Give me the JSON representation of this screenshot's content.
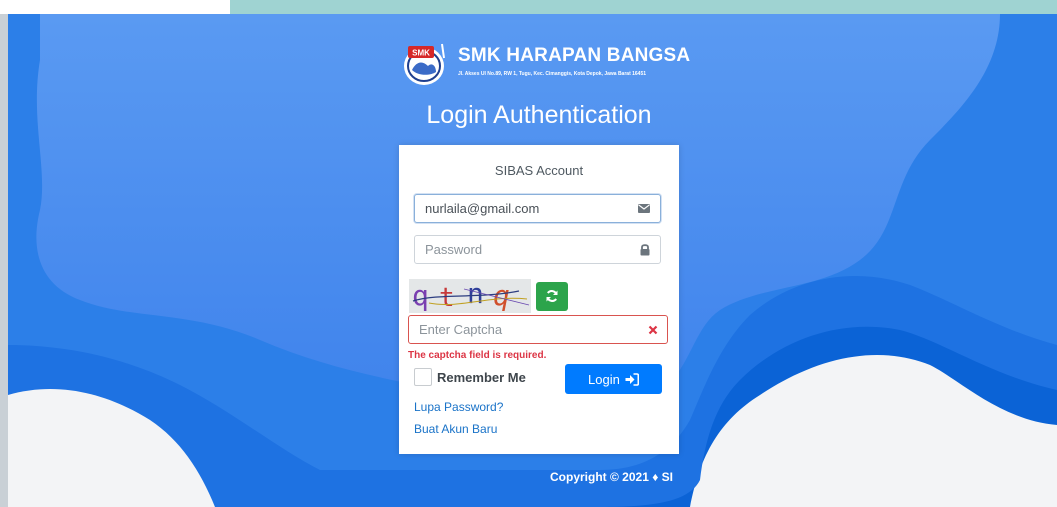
{
  "brand": {
    "seal_text": "SMK",
    "school_name": "SMK HARAPAN BANGSA",
    "address": "Jl. Akses UI No.89, RW 1, Tugu, Kec. Cimanggis, Kota Depok, Jawa Barat 16451"
  },
  "page_title": "Login Authentication",
  "card": {
    "title": "SIBAS Account",
    "email": {
      "value": "nurlaila@gmail.com",
      "icon": "envelope-icon"
    },
    "password": {
      "placeholder": "Password",
      "icon": "lock-icon"
    },
    "captcha": {
      "image_text": "qtnq",
      "placeholder": "Enter Captcha",
      "error": "The captcha field is required.",
      "refresh_icon": "refresh-icon",
      "clear_icon": "times-icon"
    },
    "remember_label": "Remember Me",
    "login_label": "Login",
    "login_icon": "sign-in-icon",
    "forgot_link": "Lupa Password?",
    "register_link": "Buat Akun Baru"
  },
  "footer": {
    "copyright": "Copyright © 2021 ♦ SI"
  },
  "colors": {
    "background_blue": "#4a8ef0",
    "primary": "#007bff",
    "success": "#2ca44b",
    "danger": "#dc3545"
  }
}
